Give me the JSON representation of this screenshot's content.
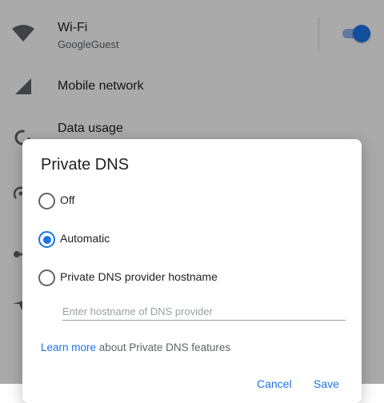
{
  "settings": {
    "wifi": {
      "title": "Wi-Fi",
      "subtitle": "GoogleGuest",
      "icon": "wifi-icon",
      "enabled": true
    },
    "mobile": {
      "title": "Mobile network",
      "icon": "signal-icon"
    },
    "data": {
      "title": "Data usage",
      "icon": "data-usage-icon"
    },
    "hidden_icons": [
      "hotspot-icon",
      "vpn-key-icon",
      "airplane-icon"
    ]
  },
  "dialog": {
    "title": "Private DNS",
    "options": [
      {
        "label": "Off",
        "selected": false
      },
      {
        "label": "Automatic",
        "selected": true
      },
      {
        "label": "Private DNS provider hostname",
        "selected": false
      }
    ],
    "hostname_placeholder": "Enter hostname of DNS provider",
    "hostname_value": "",
    "learn_more_link": "Learn more",
    "learn_more_rest": " about Private DNS features",
    "cancel_label": "Cancel",
    "save_label": "Save"
  },
  "colors": {
    "accent": "#1a73e8",
    "scrim": "rgba(0,0,0,0.32)"
  }
}
